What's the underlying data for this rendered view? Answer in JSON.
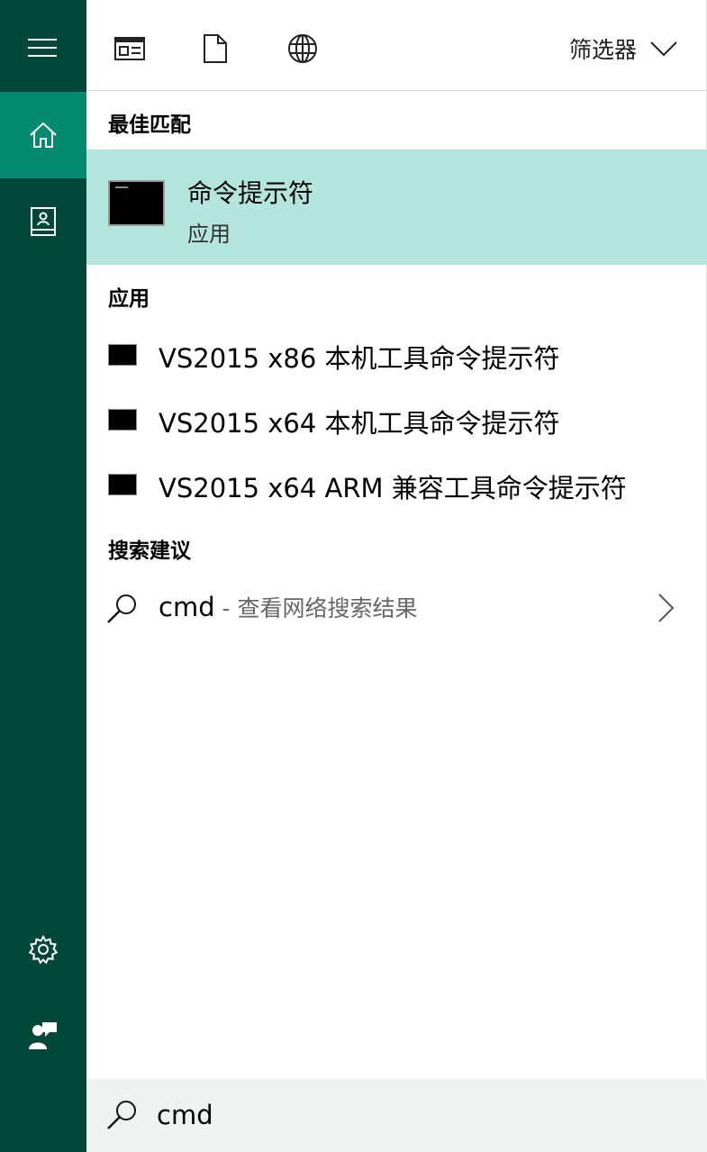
{
  "sidebar": {
    "items": [
      {
        "icon": "hamburger-menu-icon"
      },
      {
        "icon": "home-icon",
        "active": true
      },
      {
        "icon": "notebook-icon"
      },
      {
        "icon": "gear-icon"
      },
      {
        "icon": "feedback-icon"
      }
    ],
    "bg_color": "#03473b",
    "active_color": "#038a6f"
  },
  "topbar": {
    "icons": [
      "apps-icon",
      "documents-icon",
      "web-icon"
    ],
    "filter_label": "筛选器"
  },
  "best_match": {
    "section_title": "最佳匹配",
    "title": "命令提示符",
    "subtitle": "应用",
    "highlight_color": "#b4e6de"
  },
  "apps": {
    "section_title": "应用",
    "items": [
      {
        "label": "VS2015 x86 本机工具命令提示符"
      },
      {
        "label": "VS2015 x64 本机工具命令提示符"
      },
      {
        "label": "VS2015 x64 ARM 兼容工具命令提示符"
      }
    ]
  },
  "suggestions": {
    "section_title": "搜索建议",
    "query": "cmd",
    "hint": " - 查看网络搜索结果"
  },
  "searchbox": {
    "value": "cmd"
  }
}
